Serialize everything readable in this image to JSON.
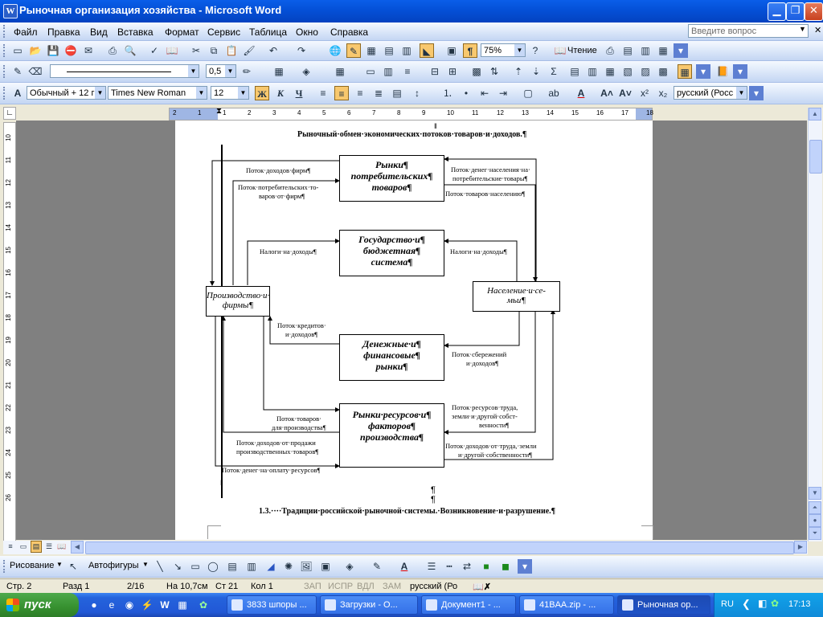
{
  "window": {
    "title": "Рыночная организация хозяйства - Microsoft Word"
  },
  "menu": [
    "Файл",
    "Правка",
    "Вид",
    "Вставка",
    "Формат",
    "Сервис",
    "Таблица",
    "Окно",
    "Справка"
  ],
  "help_placeholder": "Введите вопрос",
  "toolbar_std": {
    "zoom": "75%",
    "read_label": "Чтение"
  },
  "toolbar_draw": {
    "line_weight": "0,5"
  },
  "toolbar_format": {
    "style": "Обычный + 12 г",
    "font": "Times New Roman",
    "size": "12",
    "language": "русский (Росс"
  },
  "ruler_numbers": [
    "2",
    "1",
    "1",
    "2",
    "3",
    "4",
    "5",
    "6",
    "7",
    "8",
    "9",
    "10",
    "11",
    "12",
    "13",
    "14",
    "15",
    "16",
    "17",
    "18"
  ],
  "vruler_numbers": [
    "10",
    "11",
    "12",
    "13",
    "14",
    "15",
    "16",
    "17",
    "18",
    "19",
    "20",
    "21",
    "22",
    "23",
    "24",
    "25",
    "26"
  ],
  "doc": {
    "heading1": "Рыночный·обмен·экономических·потоков·товаров·и·доходов.¶",
    "heading2": "1.3.····Традиции·российской·рыночной·системы.·Возникновение·и·разрушение.¶",
    "pilcrow": "¶",
    "boxes": {
      "consumer": [
        "Рынки¶",
        "потребительских¶",
        "товаров¶"
      ],
      "state": [
        "Государство·и¶",
        "бюджетная¶",
        "система¶"
      ],
      "money": [
        "Денежные·и¶",
        "финансовые¶",
        "рынки¶"
      ],
      "resources": [
        "Рынки·ресурсов·и¶",
        "факторов¶",
        "производства¶"
      ],
      "firms": [
        "Производство·и·",
        "фирмы¶"
      ],
      "households": [
        "Население·и·се-",
        "мьи¶"
      ]
    },
    "labels": {
      "l1": "Поток·доходов·фирм¶",
      "l2a": "Поток·потребительских·то-",
      "l2b": "варов·от·фирм¶",
      "l3a": "Поток·денег·населения·на·",
      "l3b": "потребительские·товары¶",
      "l4": "Поток·товаров·населению¶",
      "l5": "Налоги·на·доходы¶",
      "l6": "Налоги·на·доходы¶",
      "l7a": "Поток·кредитов·",
      "l7b": "и·доходов¶",
      "l8a": "Поток·сбережений",
      "l8b": "и·доходов¶",
      "l9a": "Поток·ресурсов·труда,",
      "l9b": "земли·и·другой·собст-",
      "l9c": "венности¶",
      "l10a": "Поток·товаров·",
      "l10b": "для·производства¶",
      "l11a": "Поток·доходов·от·продажи",
      "l11b": "производственных·товаров¶",
      "l12a": "Поток·доходов·от·труда,·земли",
      "l12b": "и·другой·собственности¶",
      "l13": "Поток·денег·на·оплату·ресурсов¶"
    }
  },
  "drawing": {
    "draw_label": "Рисование",
    "autoshapes_label": "Автофигуры"
  },
  "status": {
    "page": "Стр.  2",
    "section": "Разд  1",
    "pages": "2/16",
    "at": "На 10,7см",
    "line": "Ст  21",
    "col": "Кол  1",
    "rec": "ЗАП",
    "trk": "ИСПР",
    "ext": "ВДЛ",
    "ovr": "ЗАМ",
    "lang": "русский (Ро"
  },
  "taskbar": {
    "start": "пуск",
    "tasks": [
      "3833 шпоры ...",
      "Загрузки - О...",
      "Документ1 - ...",
      "41BAA.zip - ...",
      "Рыночная ор..."
    ],
    "lang": "RU",
    "clock": "17:13"
  },
  "colors": {
    "titlebar": "#0450d7",
    "taskbar": "#2463dc",
    "start": "#36902f",
    "tray": "#0f8ad8"
  }
}
